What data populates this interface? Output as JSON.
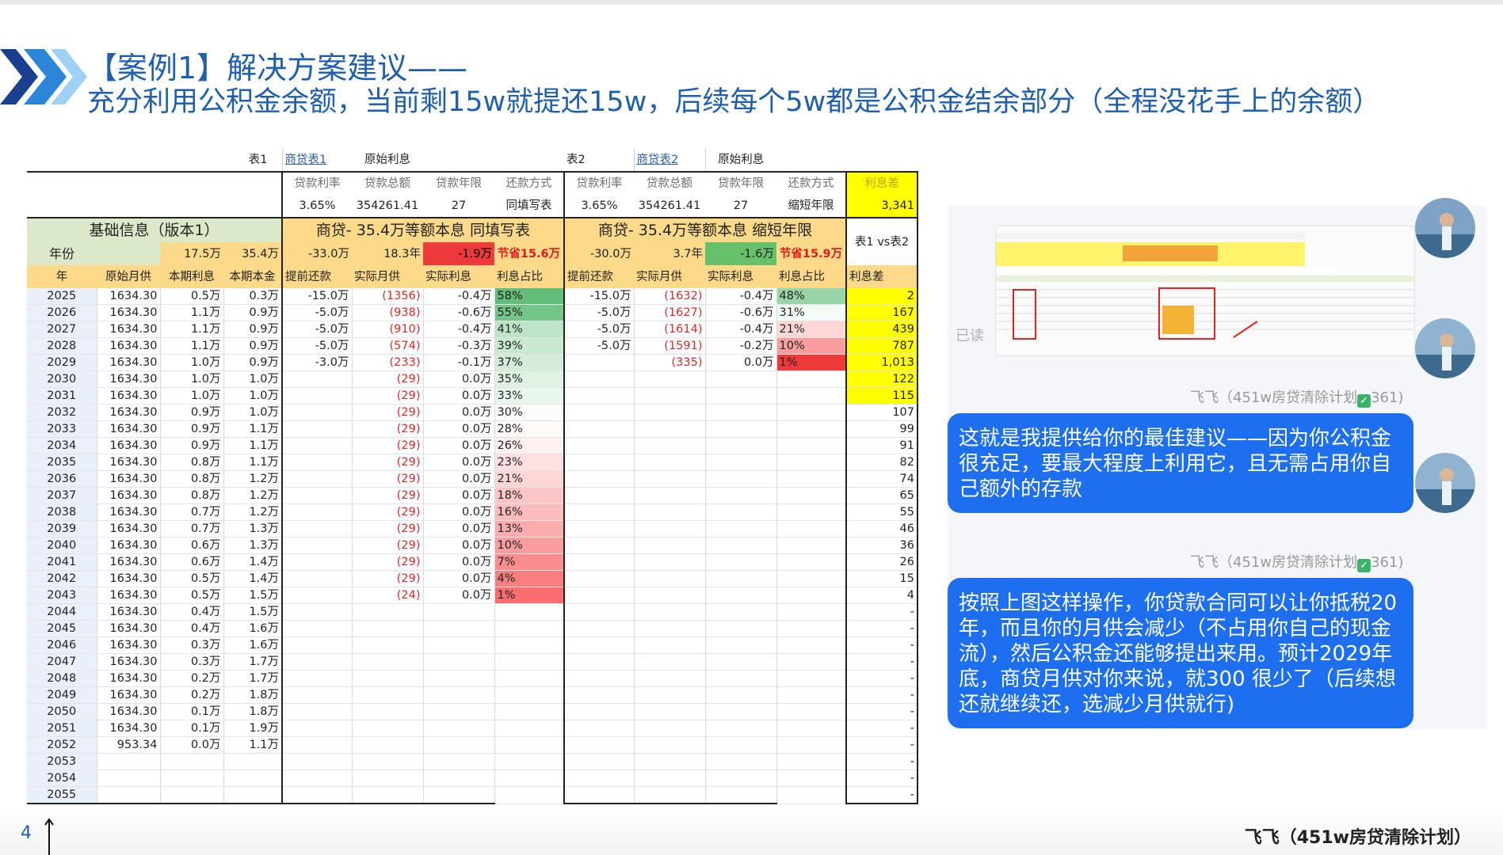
{
  "slide": {
    "title_line1": "【案例1】解决方案建议——",
    "title_line2": "充分利用公积金余额，当前剩15w就提还15w，后续每个5w都是公积金结余部分（全程没花手上的余额）",
    "page_number": "4",
    "footer": "飞飞（451w房贷清除计划）"
  },
  "sheet": {
    "top_row": {
      "t1": "表1",
      "t1_link": "商贷表1",
      "t1_orig": "原始利息",
      "t2": "表2",
      "t2_link": "商贷表2",
      "t2_orig": "原始利息"
    },
    "param_headers": [
      "贷款利率",
      "贷款总额",
      "贷款年限",
      "还款方式",
      "贷款利率",
      "贷款总额",
      "贷款年限",
      "还款方式",
      "利息差"
    ],
    "param_values": [
      "3.65%",
      "354261.41",
      "27",
      "同填写表",
      "3.65%",
      "354261.41",
      "27",
      "缩短年限",
      "3,341"
    ],
    "section": {
      "base": "基础信息（版本1）",
      "plan1": "商贷- 35.4万等额本息 同填写表",
      "plan2": "商贷- 35.4万等额本息 缩短年限",
      "compare": "表1 vs表2"
    },
    "summary": {
      "label": "年份",
      "b1": "17.5万",
      "b2": "35.4万",
      "p1a": "-33.0万",
      "p1b": "18.3年",
      "p1c": "-1.9万",
      "p1d": "节省15.6万",
      "p2a": "-30.0万",
      "p2b": "3.7年",
      "p2c": "-1.6万",
      "p2d": "节省15.9万"
    },
    "col_headers": [
      "年",
      "原始月供",
      "本期利息",
      "本期本金",
      "提前还款",
      "实际月供",
      "实际利息",
      "利息占比",
      "提前还款",
      "实际月供",
      "实际利息",
      "利息占比",
      "利息差"
    ],
    "rows": [
      [
        "2025",
        "1634.30",
        "0.5万",
        "0.3万",
        "-15.0万",
        "(1356)",
        "-0.4万",
        "58%",
        "-15.0万",
        "(1632)",
        "-0.4万",
        "48%",
        "2"
      ],
      [
        "2026",
        "1634.30",
        "1.1万",
        "0.9万",
        "-5.0万",
        "(938)",
        "-0.6万",
        "55%",
        "-5.0万",
        "(1627)",
        "-0.6万",
        "31%",
        "167"
      ],
      [
        "2027",
        "1634.30",
        "1.1万",
        "0.9万",
        "-5.0万",
        "(910)",
        "-0.4万",
        "41%",
        "-5.0万",
        "(1614)",
        "-0.4万",
        "21%",
        "439"
      ],
      [
        "2028",
        "1634.30",
        "1.1万",
        "0.9万",
        "-5.0万",
        "(574)",
        "-0.3万",
        "39%",
        "-5.0万",
        "(1591)",
        "-0.2万",
        "10%",
        "787"
      ],
      [
        "2029",
        "1634.30",
        "1.0万",
        "0.9万",
        "-3.0万",
        "(233)",
        "-0.1万",
        "37%",
        "",
        "(335)",
        "0.0万",
        "1%",
        "1,013"
      ],
      [
        "2030",
        "1634.30",
        "1.0万",
        "1.0万",
        "",
        "(29)",
        "0.0万",
        "35%",
        "",
        "",
        "",
        "",
        "122"
      ],
      [
        "2031",
        "1634.30",
        "1.0万",
        "1.0万",
        "",
        "(29)",
        "0.0万",
        "33%",
        "",
        "",
        "",
        "",
        "115"
      ],
      [
        "2032",
        "1634.30",
        "0.9万",
        "1.0万",
        "",
        "(29)",
        "0.0万",
        "30%",
        "",
        "",
        "",
        "",
        "107"
      ],
      [
        "2033",
        "1634.30",
        "0.9万",
        "1.1万",
        "",
        "(29)",
        "0.0万",
        "28%",
        "",
        "",
        "",
        "",
        "99"
      ],
      [
        "2034",
        "1634.30",
        "0.9万",
        "1.1万",
        "",
        "(29)",
        "0.0万",
        "26%",
        "",
        "",
        "",
        "",
        "91"
      ],
      [
        "2035",
        "1634.30",
        "0.8万",
        "1.1万",
        "",
        "(29)",
        "0.0万",
        "23%",
        "",
        "",
        "",
        "",
        "82"
      ],
      [
        "2036",
        "1634.30",
        "0.8万",
        "1.2万",
        "",
        "(29)",
        "0.0万",
        "21%",
        "",
        "",
        "",
        "",
        "74"
      ],
      [
        "2037",
        "1634.30",
        "0.8万",
        "1.2万",
        "",
        "(29)",
        "0.0万",
        "18%",
        "",
        "",
        "",
        "",
        "65"
      ],
      [
        "2038",
        "1634.30",
        "0.7万",
        "1.2万",
        "",
        "(29)",
        "0.0万",
        "16%",
        "",
        "",
        "",
        "",
        "55"
      ],
      [
        "2039",
        "1634.30",
        "0.7万",
        "1.3万",
        "",
        "(29)",
        "0.0万",
        "13%",
        "",
        "",
        "",
        "",
        "46"
      ],
      [
        "2040",
        "1634.30",
        "0.6万",
        "1.3万",
        "",
        "(29)",
        "0.0万",
        "10%",
        "",
        "",
        "",
        "",
        "36"
      ],
      [
        "2041",
        "1634.30",
        "0.6万",
        "1.4万",
        "",
        "(29)",
        "0.0万",
        "7%",
        "",
        "",
        "",
        "",
        "26"
      ],
      [
        "2042",
        "1634.30",
        "0.5万",
        "1.4万",
        "",
        "(29)",
        "0.0万",
        "4%",
        "",
        "",
        "",
        "",
        "15"
      ],
      [
        "2043",
        "1634.30",
        "0.5万",
        "1.5万",
        "",
        "(24)",
        "0.0万",
        "1%",
        "",
        "",
        "",
        "",
        "4"
      ],
      [
        "2044",
        "1634.30",
        "0.4万",
        "1.5万",
        "",
        "",
        "",
        "",
        "",
        "",
        "",
        "",
        "-"
      ],
      [
        "2045",
        "1634.30",
        "0.4万",
        "1.6万",
        "",
        "",
        "",
        "",
        "",
        "",
        "",
        "",
        "-"
      ],
      [
        "2046",
        "1634.30",
        "0.3万",
        "1.6万",
        "",
        "",
        "",
        "",
        "",
        "",
        "",
        "",
        "-"
      ],
      [
        "2047",
        "1634.30",
        "0.3万",
        "1.7万",
        "",
        "",
        "",
        "",
        "",
        "",
        "",
        "",
        "-"
      ],
      [
        "2048",
        "1634.30",
        "0.2万",
        "1.7万",
        "",
        "",
        "",
        "",
        "",
        "",
        "",
        "",
        "-"
      ],
      [
        "2049",
        "1634.30",
        "0.2万",
        "1.8万",
        "",
        "",
        "",
        "",
        "",
        "",
        "",
        "",
        "-"
      ],
      [
        "2050",
        "1634.30",
        "0.1万",
        "1.8万",
        "",
        "",
        "",
        "",
        "",
        "",
        "",
        "",
        "-"
      ],
      [
        "2051",
        "1634.30",
        "0.1万",
        "1.9万",
        "",
        "",
        "",
        "",
        "",
        "",
        "",
        "",
        "-"
      ],
      [
        "2052",
        "953.34",
        "0.0万",
        "1.1万",
        "",
        "",
        "",
        "",
        "",
        "",
        "",
        "",
        "-"
      ],
      [
        "2053",
        "",
        "",
        "",
        "",
        "",
        "",
        "",
        "",
        "",
        "",
        "",
        "-"
      ],
      [
        "2054",
        "",
        "",
        "",
        "",
        "",
        "",
        "",
        "",
        "",
        "",
        "",
        "-"
      ],
      [
        "2055",
        "",
        "",
        "",
        "",
        "",
        "",
        "",
        "",
        "",
        "",
        "",
        "-"
      ]
    ],
    "p1_ratio_values": [
      58,
      55,
      41,
      39,
      37,
      35,
      33,
      30,
      28,
      26,
      23,
      21,
      18,
      16,
      13,
      10,
      7,
      4,
      1
    ],
    "p2_ratio_values": [
      48,
      31,
      21,
      10,
      1
    ]
  },
  "chat": {
    "read_label": "已读",
    "sender_name": "飞飞（451w房贷清除计划",
    "sender_badge": "361)",
    "message1": "这就是我提供给你的最佳建议——因为你公积金很充足，要最大程度上利用它，且无需占用你自己额外的存款",
    "message2": "按照上图这样操作，你贷款合同可以让你抵税20年，而且你的月供会减少（不占用你自己的现金流），然后公积金还能够提出来用。预计2029年底，商贷月供对你来说，就300 很少了（后续想还就继续还，选减少月供就行)"
  },
  "colors": {
    "title_blue": "#1f5fae",
    "bubble_blue": "#1e6ff0",
    "green_header": "#dce9c9",
    "orange_header": "#fdd98a",
    "highlight_yellow": "#ffff00",
    "bar_green": "#63be7b",
    "bar_red": "#f8696b"
  }
}
